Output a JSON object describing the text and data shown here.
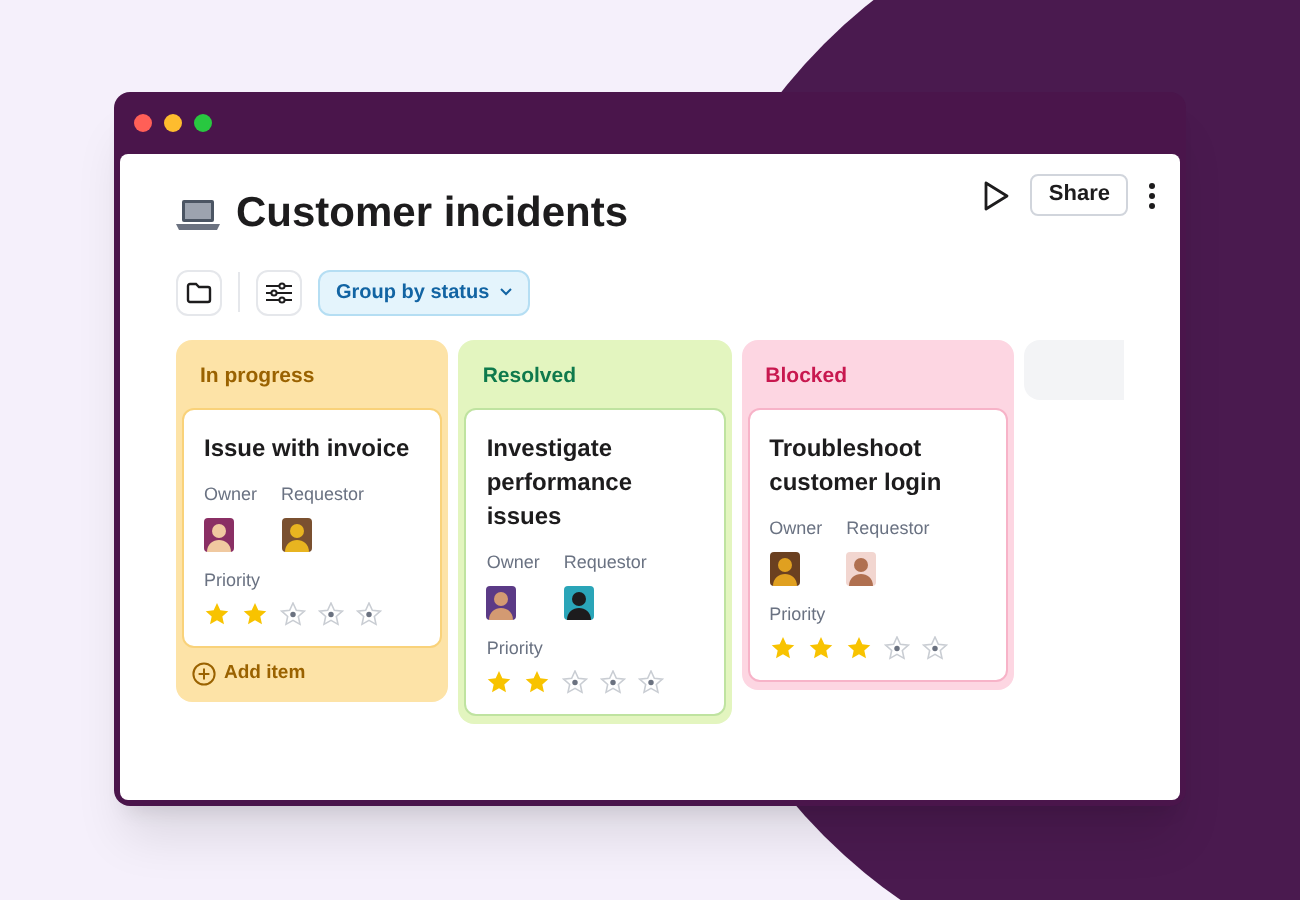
{
  "window": {
    "title": "Customer incidents"
  },
  "header_actions": {
    "share": "Share"
  },
  "toolbar": {
    "group_by": "Group by status"
  },
  "columns": [
    {
      "title": "In progress",
      "kind": "progress",
      "add_item": "Add item",
      "cards": [
        {
          "title": "Issue with invoice",
          "owner_label": "Owner",
          "requestor_label": "Requestor",
          "priority_label": "Priority",
          "stars": 2
        }
      ]
    },
    {
      "title": "Resolved",
      "kind": "resolved",
      "cards": [
        {
          "title": "Investigate performance issues",
          "owner_label": "Owner",
          "requestor_label": "Requestor",
          "priority_label": "Priority",
          "stars": 2
        }
      ]
    },
    {
      "title": "Blocked",
      "kind": "blocked",
      "cards": [
        {
          "title": "Troubleshoot customer login",
          "owner_label": "Owner",
          "requestor_label": "Requestor",
          "priority_label": "Priority",
          "stars": 3
        }
      ]
    }
  ]
}
